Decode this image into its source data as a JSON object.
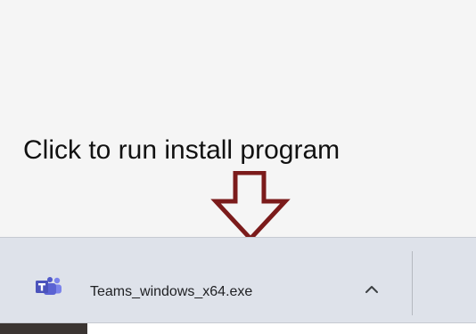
{
  "instruction": {
    "text": "Click to run install program",
    "arrow_color": "#7b1b1b"
  },
  "download_bar": {
    "background": "#dee2ea",
    "item": {
      "icon": "teams-icon",
      "filename": "Teams_windows_x64.exe",
      "menu_icon": "chevron-up-icon"
    }
  },
  "colors": {
    "teams_brand": "#4b53bc",
    "teams_accent": "#7b83eb"
  }
}
